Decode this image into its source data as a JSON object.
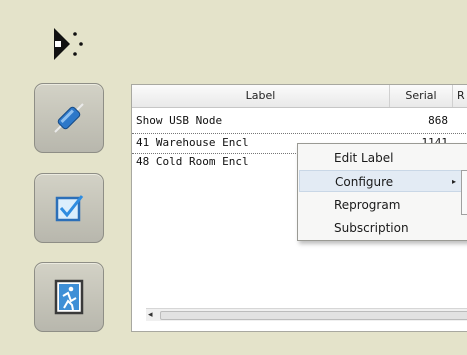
{
  "app": {
    "logo_icon": "app-logo-icon",
    "accent": "#1e6fd0"
  },
  "sidebar": {
    "buttons": [
      {
        "icon": "usb-connection-icon"
      },
      {
        "icon": "checkbox-icon"
      },
      {
        "icon": "exit-door-icon"
      }
    ]
  },
  "grid": {
    "columns": [
      "Label",
      "Serial",
      "R"
    ],
    "rows": [
      {
        "label": "Show USB Node",
        "serial": "868"
      },
      {
        "label": "41 Warehouse Encl",
        "serial": "1141"
      },
      {
        "label": "48 Cold Room Encl",
        "serial": ""
      }
    ]
  },
  "context_menu": {
    "items": [
      "Edit Label",
      "Configure",
      "Reprogram",
      "Subscription"
    ],
    "submenu_arrow": "▸"
  }
}
